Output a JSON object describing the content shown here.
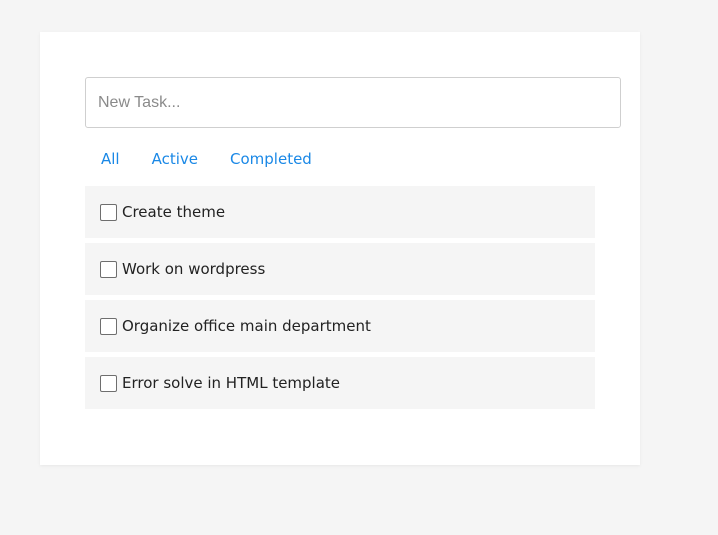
{
  "new_task": {
    "placeholder": "New Task...",
    "value": ""
  },
  "filters": [
    {
      "label": "All"
    },
    {
      "label": "Active"
    },
    {
      "label": "Completed"
    }
  ],
  "tasks": [
    {
      "label": "Create theme",
      "completed": false
    },
    {
      "label": "Work on wordpress",
      "completed": false
    },
    {
      "label": "Organize office main department",
      "completed": false
    },
    {
      "label": "Error solve in HTML template",
      "completed": false
    }
  ],
  "colors": {
    "accent": "#1a88e6",
    "page_background": "#f5f5f5",
    "task_background": "#f5f5f5",
    "card_background": "#ffffff"
  }
}
